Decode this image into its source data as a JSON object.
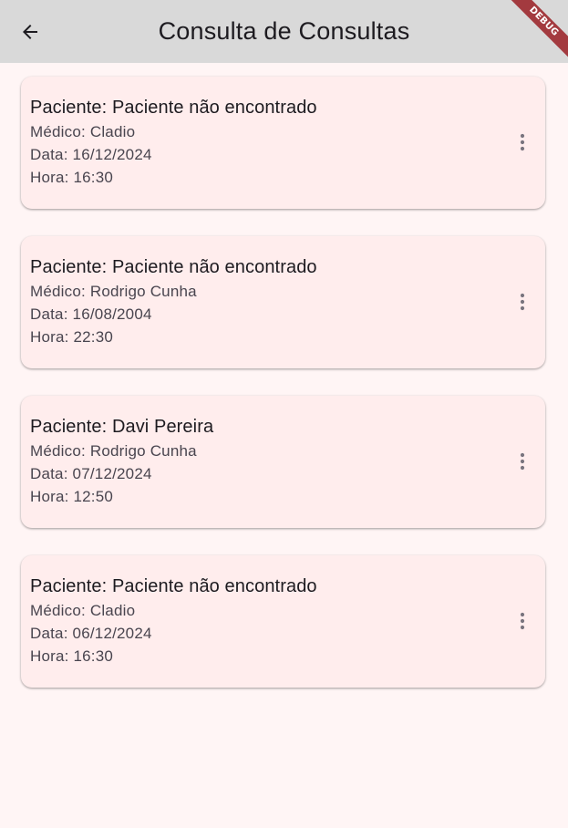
{
  "app_bar": {
    "title": "Consulta de Consultas",
    "back_icon": "arrow-left-icon",
    "debug_label": "DEBUG"
  },
  "colors": {
    "app_bar": "#d9d9d9",
    "background": "#fff5f5",
    "card": "#ffeded",
    "debug_ribbon": "#a33a3f"
  },
  "appointments": [
    {
      "patient": "Paciente: Paciente não encontrado",
      "doctor": "Médico: Cladio",
      "date": "Data: 16/12/2024",
      "time": "Hora: 16:30",
      "menu_icon": "more-vert-icon"
    },
    {
      "patient": "Paciente: Paciente não encontrado",
      "doctor": "Médico: Rodrigo Cunha",
      "date": "Data: 16/08/2004",
      "time": "Hora: 22:30",
      "menu_icon": "more-vert-icon"
    },
    {
      "patient": "Paciente: Davi Pereira",
      "doctor": "Médico: Rodrigo Cunha",
      "date": "Data: 07/12/2024",
      "time": "Hora: 12:50",
      "menu_icon": "more-vert-icon"
    },
    {
      "patient": "Paciente: Paciente não encontrado",
      "doctor": "Médico: Cladio",
      "date": "Data: 06/12/2024",
      "time": "Hora: 16:30",
      "menu_icon": "more-vert-icon"
    }
  ]
}
